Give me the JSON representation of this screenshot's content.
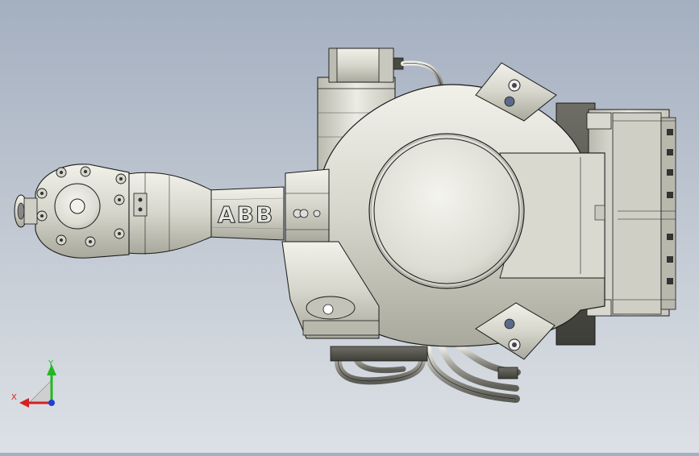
{
  "viewport": {
    "model_logo_text": "ABB",
    "triad": {
      "x_label": "X",
      "y_label": "Y"
    },
    "colors": {
      "background_top": "#a4afc0",
      "background_bottom": "#dde1e6",
      "metal_base": "#d8d8d0",
      "metal_shadow": "#8a8a80",
      "outline": "#1a1a1a",
      "axis_x": "#d42020",
      "axis_y": "#22b822",
      "axis_z": "#2040d0"
    }
  }
}
